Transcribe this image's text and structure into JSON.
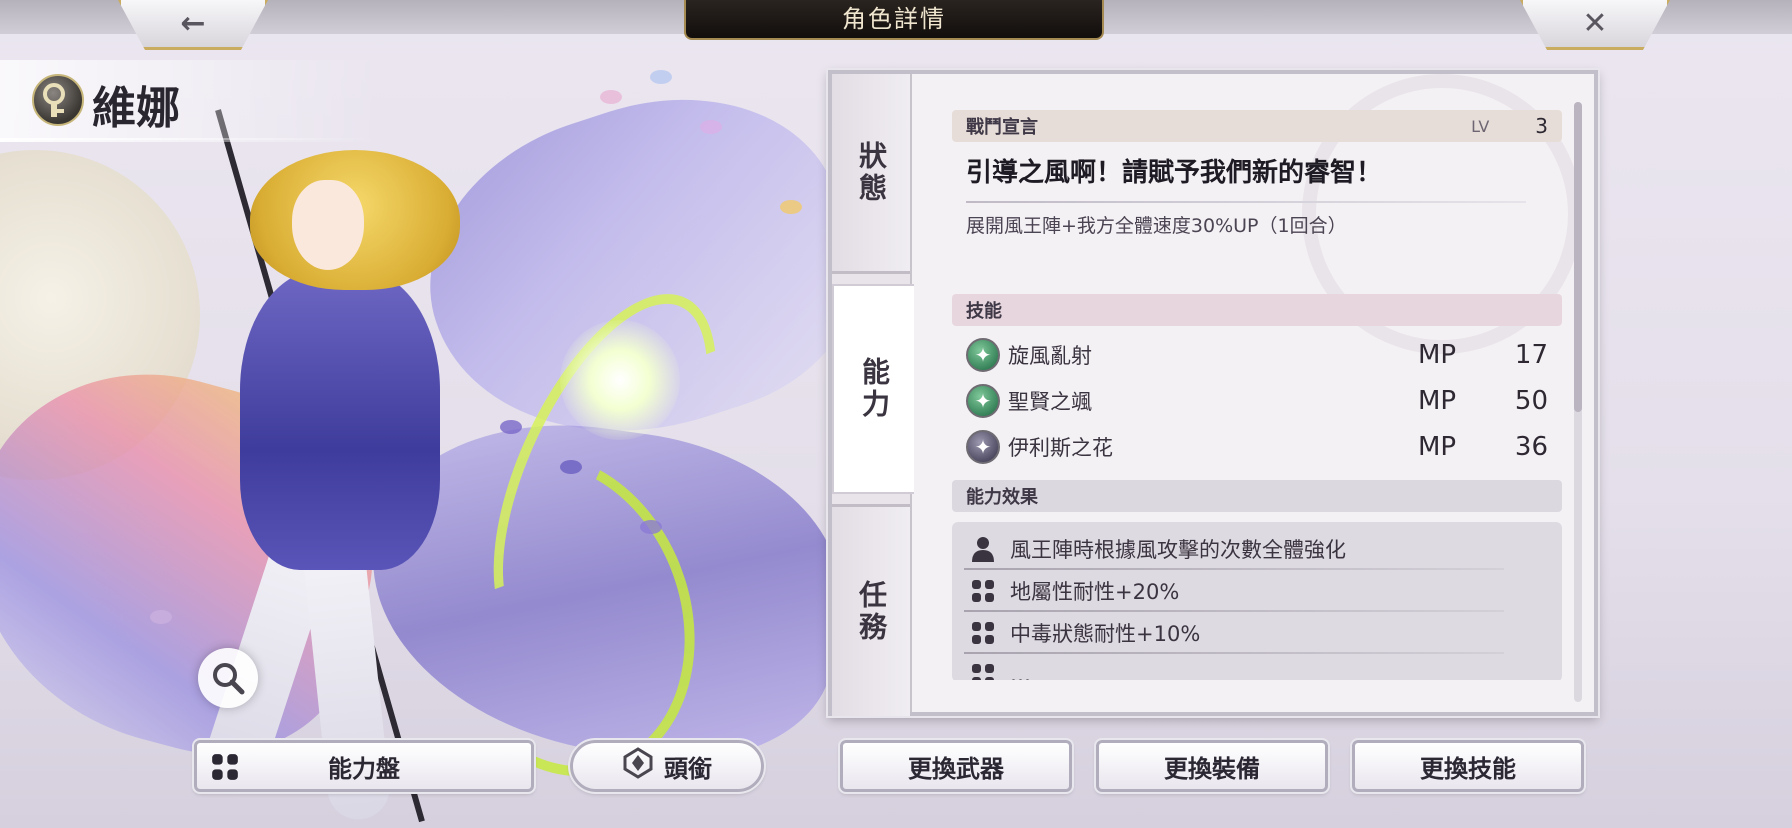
{
  "header": {
    "title": "角色詳情",
    "back_icon": "←",
    "close_icon": "✕"
  },
  "character": {
    "name": "維娜",
    "name_icon": "key-icon"
  },
  "tabs": [
    {
      "label": "狀態"
    },
    {
      "label": "能力"
    },
    {
      "label": "任務"
    }
  ],
  "battle_declaration": {
    "header": "戰鬥宣言",
    "lv_label": "LV",
    "lv_value": "3",
    "title": "引導之風啊！請賦予我們新的睿智！",
    "description": "展開風王陣+我方全體速度30%UP（1回合）"
  },
  "skills": {
    "header": "技能",
    "items": [
      {
        "name": "旋風亂射",
        "mp_label": "MP",
        "mp": "17",
        "icon": "wind-star-icon",
        "icon_color": "#3f8a60"
      },
      {
        "name": "聖賢之颯",
        "mp_label": "MP",
        "mp": "50",
        "icon": "wind-star-icon",
        "icon_color": "#3f8a60"
      },
      {
        "name": "伊利斯之花",
        "mp_label": "MP",
        "mp": "36",
        "icon": "star-icon",
        "icon_color": "#4d4a66"
      }
    ]
  },
  "ability_effects": {
    "header": "能力效果",
    "items": [
      {
        "text": "風王陣時根據風攻擊的次數全體強化",
        "icon": "person-icon"
      },
      {
        "text": "地屬性耐性+20%",
        "icon": "grid-icon"
      },
      {
        "text": "中毒狀態耐性+10%",
        "icon": "grid-icon"
      },
      {
        "text": "…",
        "icon": "grid-icon"
      }
    ]
  },
  "bottom_buttons": {
    "ability_board": "能力盤",
    "title": "頭銜",
    "change_weapon": "更換武器",
    "change_equipment": "更換裝備",
    "change_skill": "更換技能"
  },
  "colors": {
    "accent_gold": "#c9ac5f",
    "panel_bg": "#f4f1f5",
    "skill_green": "#3f8a60"
  }
}
